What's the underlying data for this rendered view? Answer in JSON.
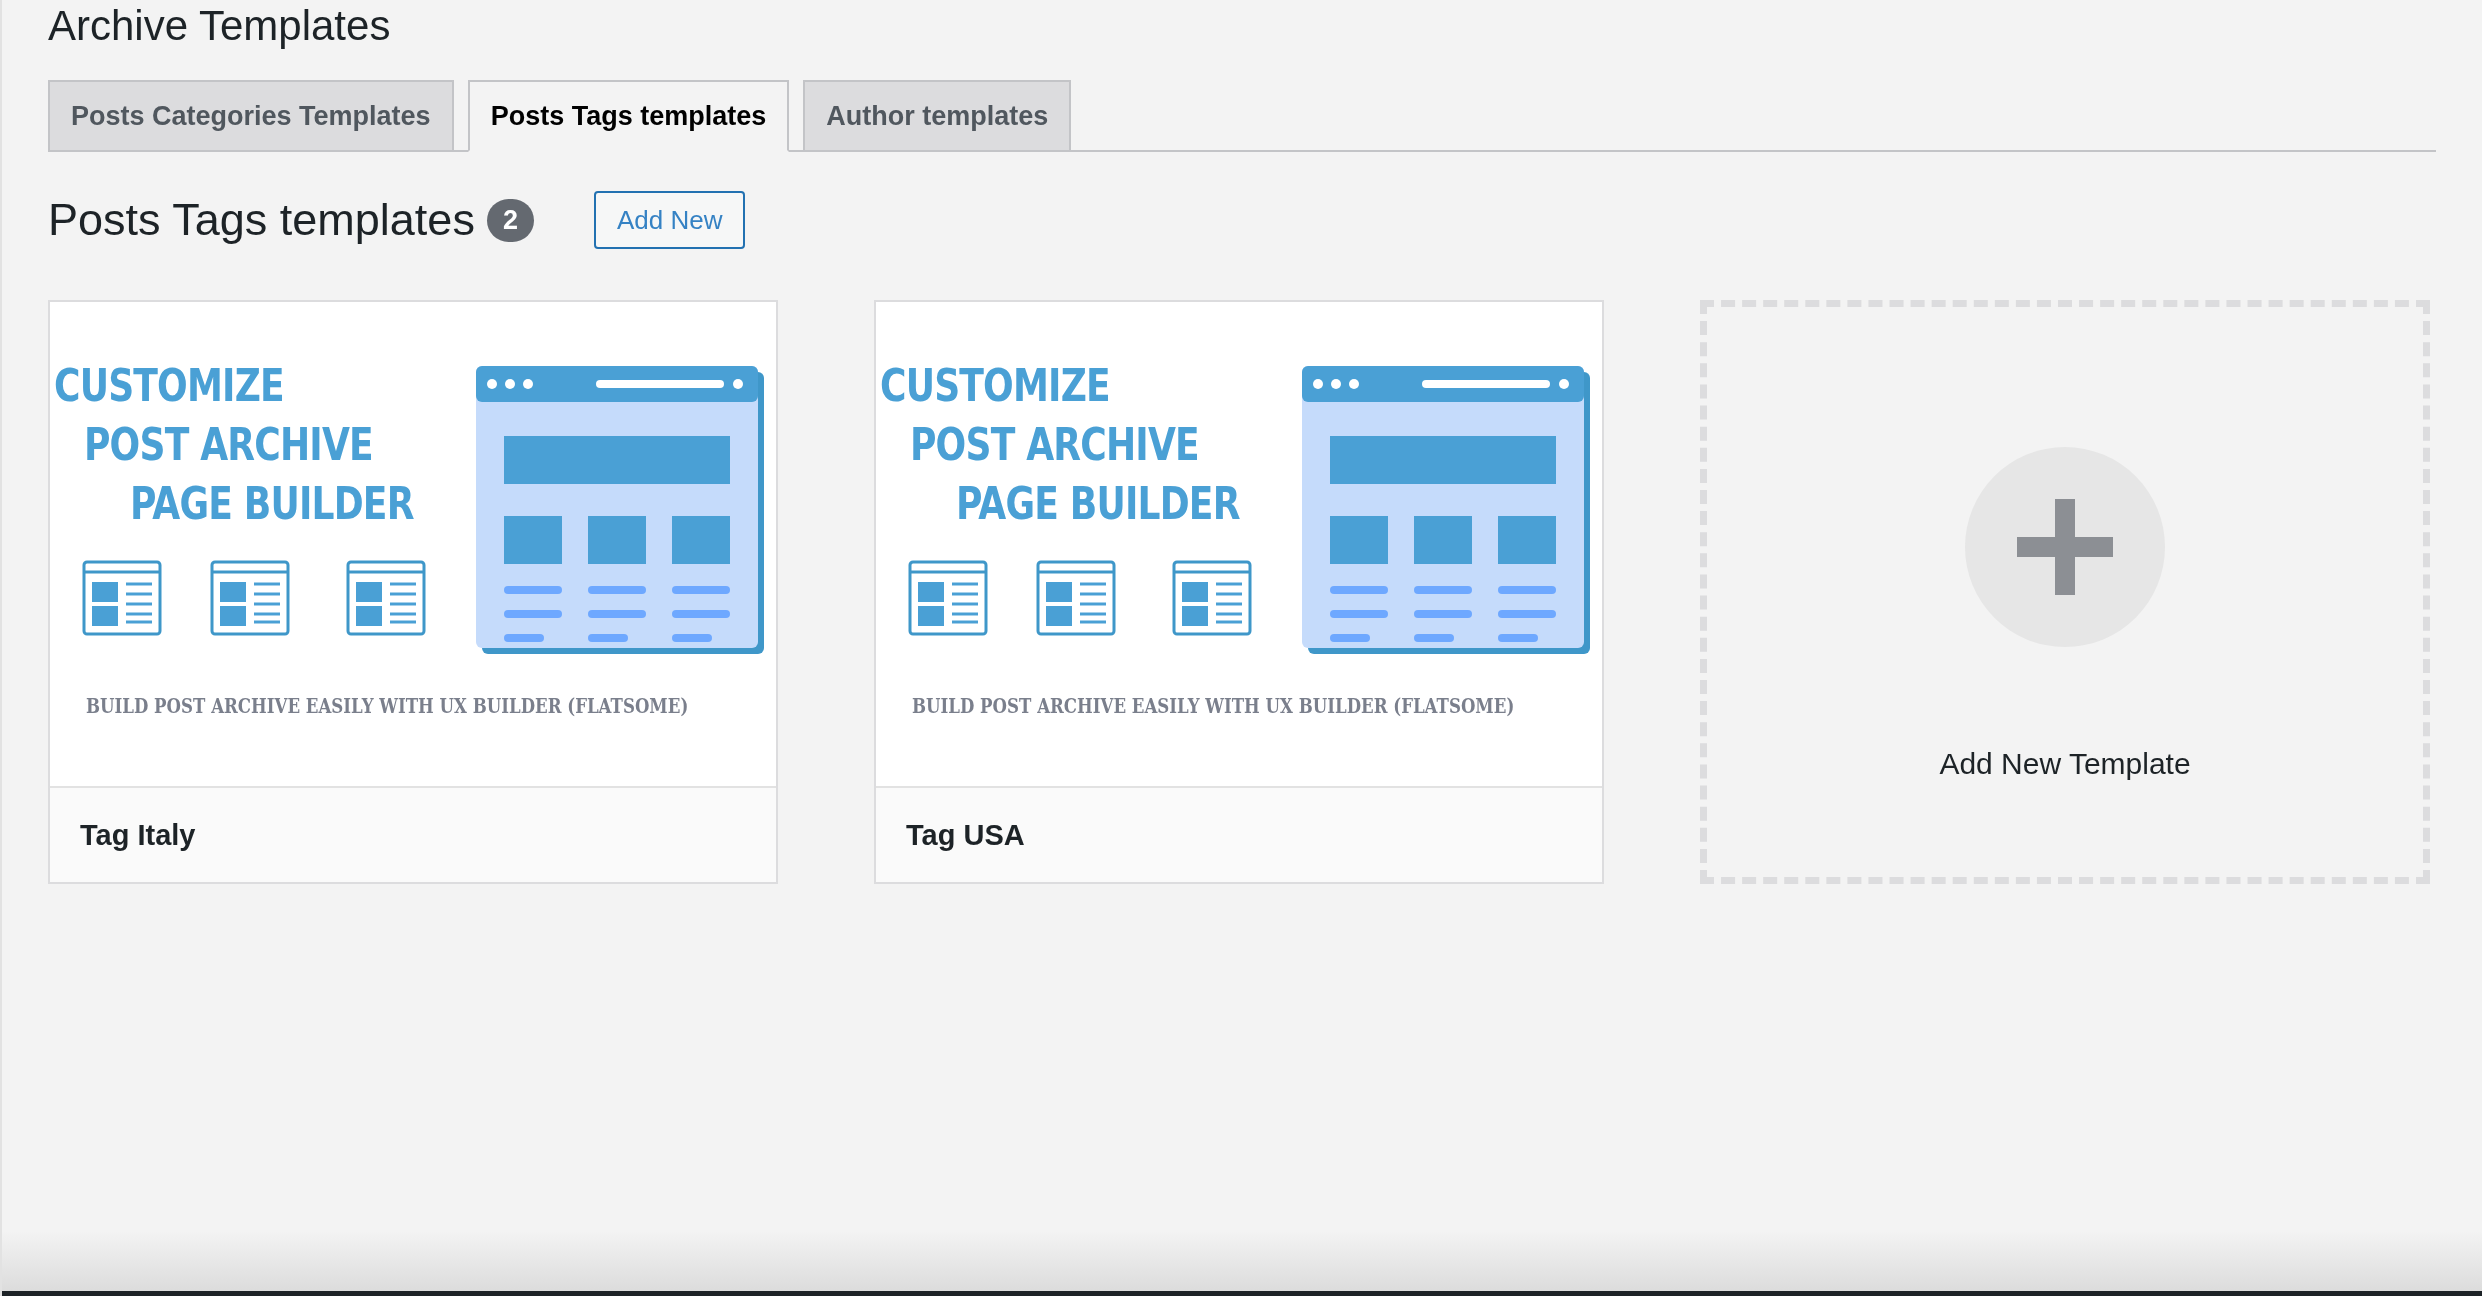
{
  "page_title": "Archive Templates",
  "tabs": [
    {
      "label": "Posts Categories Templates",
      "selected": false
    },
    {
      "label": "Posts Tags templates",
      "selected": true
    },
    {
      "label": "Author templates",
      "selected": false
    }
  ],
  "section": {
    "title": "Posts Tags templates",
    "count": "2",
    "add_button": "Add New"
  },
  "templates": [
    {
      "name": "Tag Italy",
      "thumbnail": {
        "headline": [
          "CUSTOMIZE",
          "POST ARCHIVE",
          "PAGE BUILDER"
        ],
        "caption": "BUILD POST ARCHIVE EASILY WITH UX BUILDER (FLATSOME)"
      }
    },
    {
      "name": "Tag USA",
      "thumbnail": {
        "headline": [
          "CUSTOMIZE",
          "POST ARCHIVE",
          "PAGE BUILDER"
        ],
        "caption": "BUILD POST ARCHIVE EASILY WITH UX BUILDER (FLATSOME)"
      }
    }
  ],
  "add_card": {
    "label": "Add New Template"
  }
}
